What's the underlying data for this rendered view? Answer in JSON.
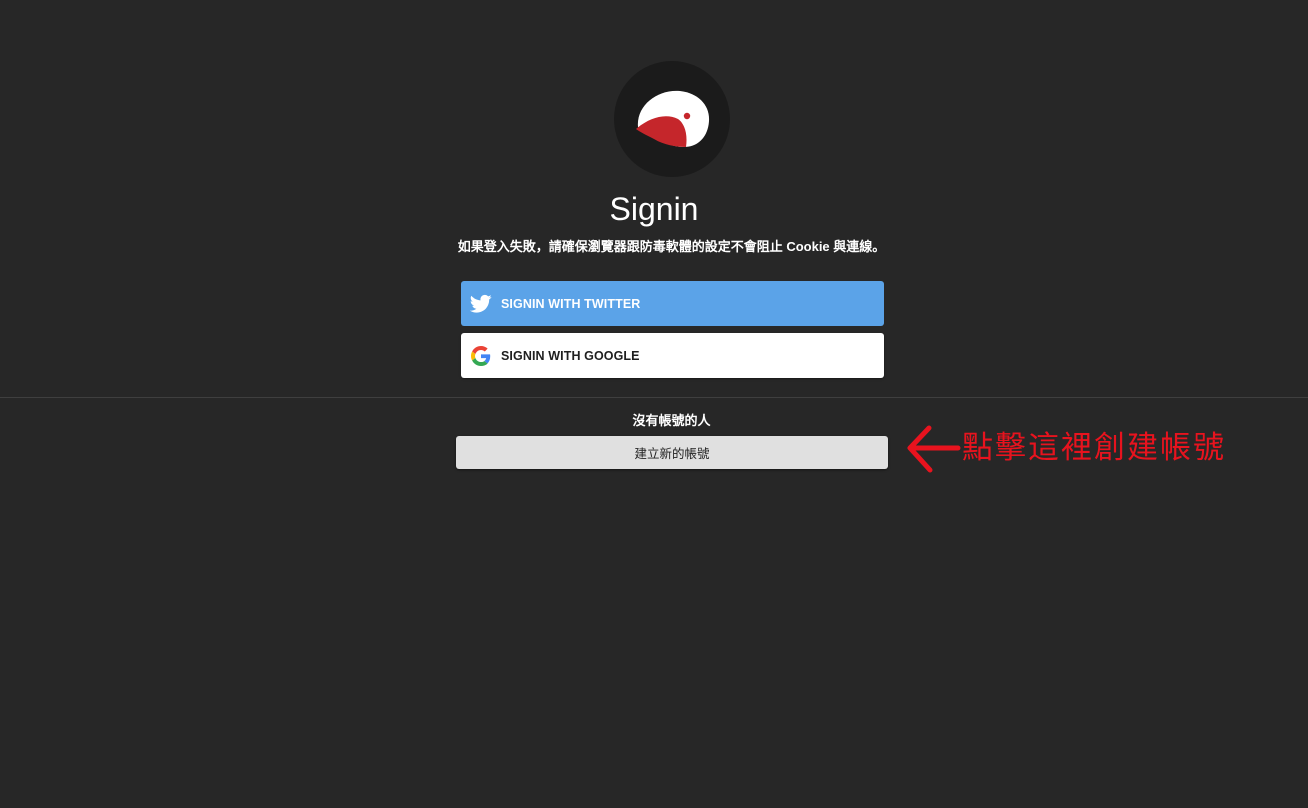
{
  "page": {
    "title": "Signin",
    "notice": "如果登入失敗，請確保瀏覽器跟防毒軟體的設定不會阻止 Cookie 與連線。"
  },
  "logo": {
    "icon": "bird-logo-icon"
  },
  "auth_buttons": [
    {
      "label": "SIGNIN WITH TWITTER",
      "icon": "twitter-bird-icon",
      "color": "#5ba3e8"
    },
    {
      "label": "SIGNIN WITH GOOGLE",
      "icon": "google-g-icon",
      "color": "#ffffff"
    }
  ],
  "signup": {
    "prompt": "沒有帳號的人",
    "button_label": "建立新的帳號"
  },
  "annotation": {
    "text": "點擊這裡創建帳號",
    "color": "#e8131e",
    "icon": "arrow-left-icon"
  }
}
